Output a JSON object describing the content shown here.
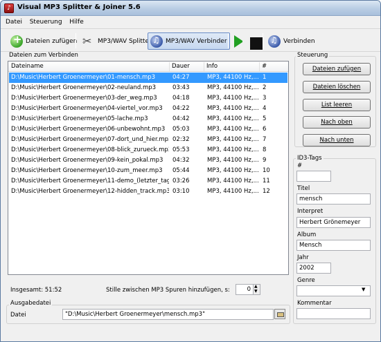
{
  "window": {
    "title": "Visual MP3 Splitter & Joiner 5.6"
  },
  "menu": {
    "items": [
      "Datei",
      "Steuerung",
      "Hilfe"
    ]
  },
  "toolbar": {
    "add_files": "Dateien zufügen",
    "splitter": "MP3/WAV Splitter",
    "joiner": "MP3/WAV Verbinder",
    "join": "Verbinden"
  },
  "files_group": {
    "label": "Dateien zum Verbinden",
    "columns": {
      "name": "Dateiname",
      "duration": "Dauer",
      "info": "Info",
      "num": "#"
    },
    "rows": [
      {
        "name": "D:\\Music\\Herbert Groenermeyer\\01-mensch.mp3",
        "duration": "04:27",
        "info": "MP3, 44100 Hz,...",
        "num": "1"
      },
      {
        "name": "D:\\Music\\Herbert Groenermeyer\\02-neuland.mp3",
        "duration": "03:43",
        "info": "MP3, 44100 Hz,...",
        "num": "2"
      },
      {
        "name": "D:\\Music\\Herbert Groenermeyer\\03-der_weg.mp3",
        "duration": "04:18",
        "info": "MP3, 44100 Hz,...",
        "num": "3"
      },
      {
        "name": "D:\\Music\\Herbert Groenermeyer\\04-viertel_vor.mp3",
        "duration": "04:22",
        "info": "MP3, 44100 Hz,...",
        "num": "4"
      },
      {
        "name": "D:\\Music\\Herbert Groenermeyer\\05-lache.mp3",
        "duration": "04:42",
        "info": "MP3, 44100 Hz,...",
        "num": "5"
      },
      {
        "name": "D:\\Music\\Herbert Groenermeyer\\06-unbewohnt.mp3",
        "duration": "05:03",
        "info": "MP3, 44100 Hz,...",
        "num": "6"
      },
      {
        "name": "D:\\Music\\Herbert Groenermeyer\\07-dort_und_hier.mp3",
        "duration": "02:32",
        "info": "MP3, 44100 Hz,...",
        "num": "7"
      },
      {
        "name": "D:\\Music\\Herbert Groenermeyer\\08-blick_zurueck.mp3",
        "duration": "05:53",
        "info": "MP3, 44100 Hz,...",
        "num": "8"
      },
      {
        "name": "D:\\Music\\Herbert Groenermeyer\\09-kein_pokal.mp3",
        "duration": "04:32",
        "info": "MP3, 44100 Hz,...",
        "num": "9"
      },
      {
        "name": "D:\\Music\\Herbert Groenermeyer\\10-zum_meer.mp3",
        "duration": "05:44",
        "info": "MP3, 44100 Hz,...",
        "num": "10"
      },
      {
        "name": "D:\\Music\\Herbert Groenermeyer\\11-demo_(letzter_tag)....",
        "duration": "03:26",
        "info": "MP3, 44100 Hz,...",
        "num": "11"
      },
      {
        "name": "D:\\Music\\Herbert Groenermeyer\\12-hidden_track.mp3",
        "duration": "03:10",
        "info": "MP3, 44100 Hz,...",
        "num": "12"
      }
    ],
    "selected_index": 0
  },
  "summary": {
    "total": "Insgesamt: 51:52",
    "silence_label": "Stille zwischen MP3 Spuren hinzufügen, s:",
    "silence_value": "0"
  },
  "output": {
    "label": "Ausgabedatei",
    "file_label": "Datei",
    "file_value": "\"D:\\Music\\Herbert Groenermeyer\\mensch.mp3\""
  },
  "control": {
    "label": "Steuerung",
    "buttons": [
      "Dateien zufügen",
      "Dateien löschen",
      "List leeren",
      "Nach oben",
      "Nach unten"
    ]
  },
  "id3": {
    "label": "ID3-Tags",
    "num_label": "#",
    "num_value": "",
    "title_label": "Titel",
    "title_value": "mensch",
    "artist_label": "Interpret",
    "artist_value": "Herbert Grönemeyer",
    "album_label": "Album",
    "album_value": "Mensch",
    "year_label": "Jahr",
    "year_value": "2002",
    "genre_label": "Genre",
    "genre_value": "",
    "comment_label": "Kommentar",
    "comment_value": ""
  }
}
